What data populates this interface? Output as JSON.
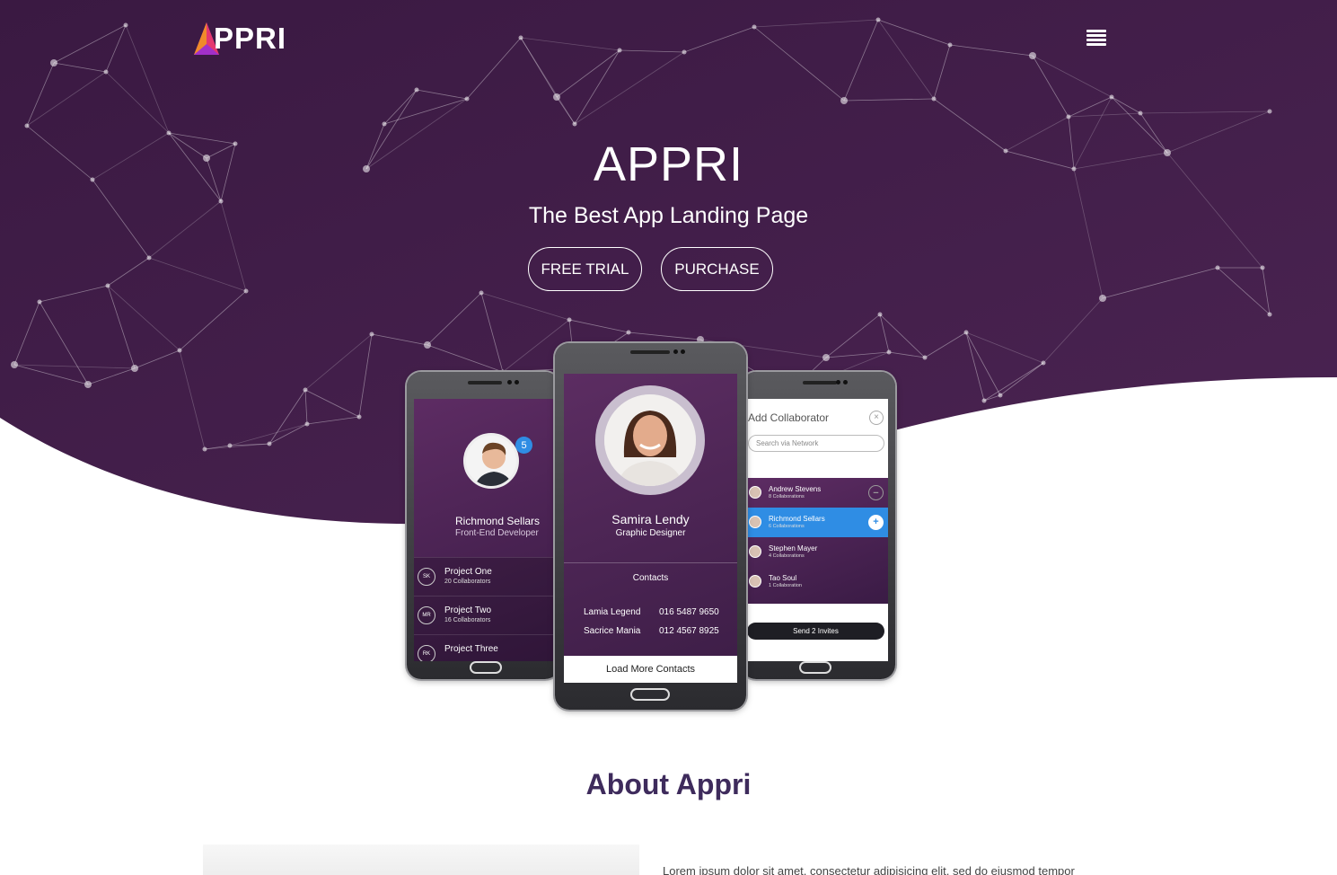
{
  "brand": {
    "logo_text": "PPRI"
  },
  "colors": {
    "hero_bg": "#3d1a46",
    "accent_blue": "#2f8de4",
    "about_title": "#3e2b5c"
  },
  "hero": {
    "title": "APPRI",
    "subtitle": "The Best App Landing Page",
    "buttons": {
      "free_trial": "FREE TRIAL",
      "purchase": "PURCHASE"
    }
  },
  "phone_left": {
    "badge": "5",
    "name": "Richmond Sellars",
    "role": "Front-End Developer",
    "projects": [
      {
        "initials": "SK",
        "title": "Project One",
        "meta": "20 Collaborators"
      },
      {
        "initials": "MR",
        "title": "Project Two",
        "meta": "16 Collaborators"
      },
      {
        "initials": "RK",
        "title": "Project Three",
        "meta": ""
      }
    ]
  },
  "phone_mid": {
    "name": "Samira Lendy",
    "role": "Graphic Designer",
    "contacts_label": "Contacts",
    "contacts": [
      {
        "name": "Lamia Legend",
        "phone": "016 5487 9650"
      },
      {
        "name": "Sacrice Mania",
        "phone": "012 4567 8925"
      }
    ],
    "load_more": "Load More Contacts"
  },
  "phone_right": {
    "title": "Add Collaborator",
    "search_placeholder": "Search via Network",
    "people": [
      {
        "name": "Andrew Stevens",
        "meta": "8 Collaborations",
        "action": "−"
      },
      {
        "name": "Richmond Sellars",
        "meta": "6 Collaborations",
        "action": "+"
      },
      {
        "name": "Stephen Mayer",
        "meta": "4 Collaborations",
        "action": ""
      },
      {
        "name": "Tao Soul",
        "meta": "1 Collaboration",
        "action": ""
      }
    ],
    "send_button": "Send 2 Invites"
  },
  "about": {
    "title": "About Appri",
    "text": "Lorem ipsum dolor sit amet, consectetur adipisicing elit, sed do eiusmod tempor"
  },
  "icons": {
    "menu": "hamburger-icon",
    "close": "close-circle-icon"
  }
}
